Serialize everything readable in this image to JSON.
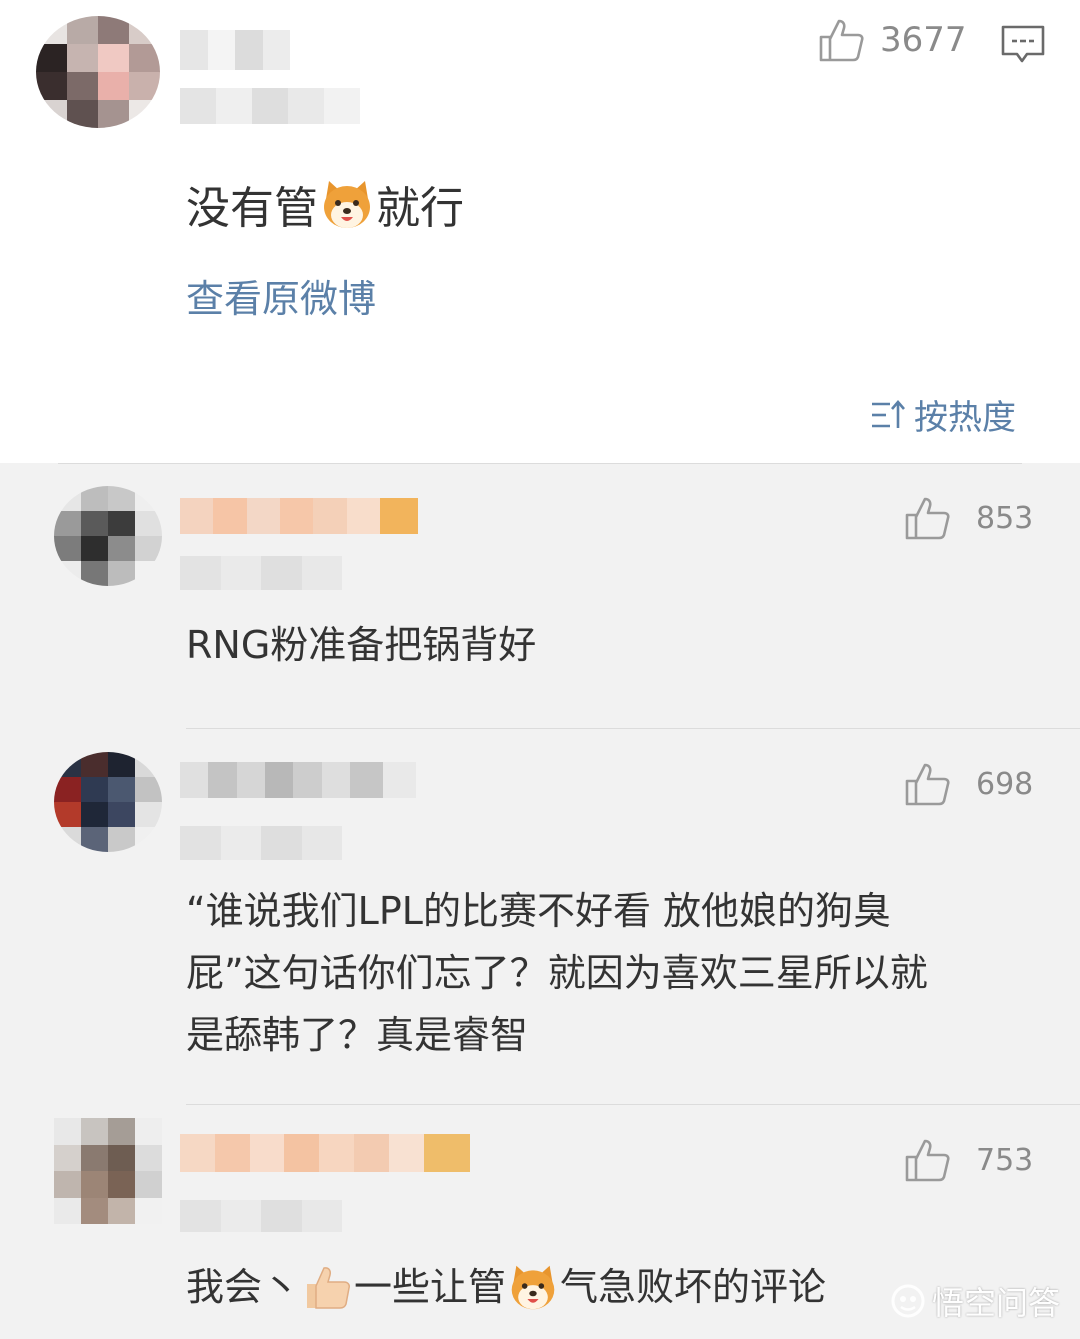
{
  "main_post": {
    "like_count": "3677",
    "text_before": "没有管",
    "emoji_name": "shiba-dog-emoji",
    "text_after": "就行",
    "view_original_label": "查看原微博",
    "sort_label": "按热度"
  },
  "comments": [
    {
      "like_count": "853",
      "lines": [
        "RNG粉准备把锅背好"
      ]
    },
    {
      "like_count": "698",
      "lines": [
        "“谁说我们LPL的比赛不好看 放他娘的狗臭",
        "屁”这句话你们忘了？就因为喜欢三星所以就",
        "是舔韩了？真是睿智"
      ]
    },
    {
      "like_count": "753",
      "part1": "我会丶",
      "part2": "一些让管",
      "part3": "气急败坏的评论"
    }
  ],
  "watermark": "悟空问答",
  "colors": {
    "link": "#5b80a8",
    "text": "#333333",
    "muted": "#8a8a8a",
    "background": "#f2f2f2"
  }
}
